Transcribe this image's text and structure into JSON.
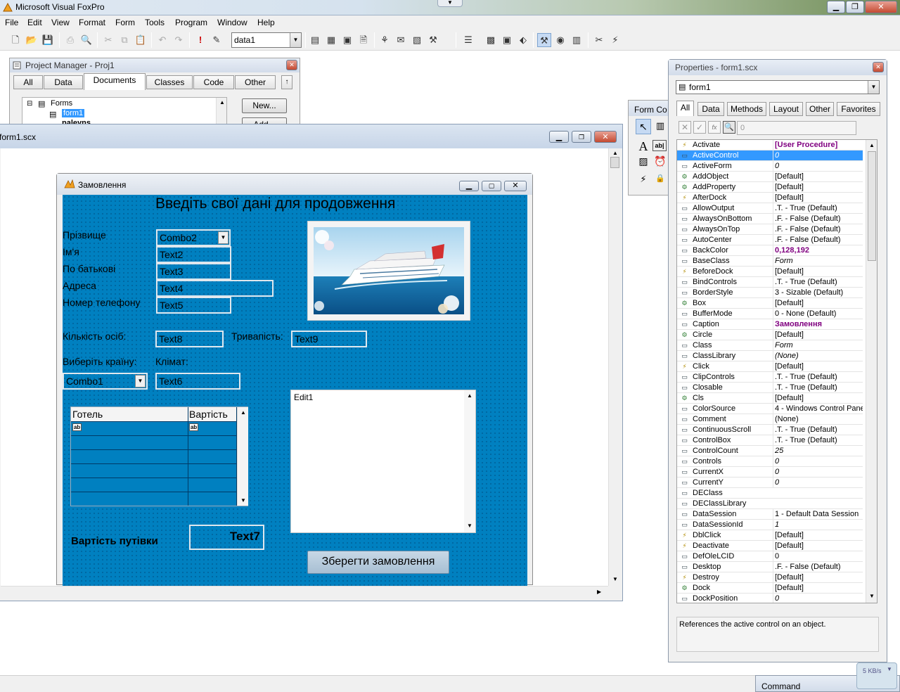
{
  "app": {
    "title": "Microsoft Visual FoxPro"
  },
  "menu": [
    "File",
    "Edit",
    "View",
    "Format",
    "Form",
    "Tools",
    "Program",
    "Window",
    "Help"
  ],
  "toolbar": {
    "datasession_value": "data1"
  },
  "project_manager": {
    "title": "Project Manager - Proj1",
    "tabs": [
      "All",
      "Data",
      "Documents",
      "Classes",
      "Code",
      "Other"
    ],
    "active_tab": "Documents",
    "tree": {
      "root": "Forms",
      "items": [
        "form1",
        "paleyns"
      ]
    },
    "new_button": "New...",
    "add_button": "Add..."
  },
  "form_designer": {
    "title": "form1.scx"
  },
  "form": {
    "caption": "Замовлення",
    "heading": "Введіть свої дані для продовження",
    "labels": {
      "surname": "Прізвище",
      "name": "Ім'я",
      "patronymic": "По батькові",
      "address": "Адреса",
      "phone": "Номер телефону",
      "persons": "Кількість осіб:",
      "duration": "Тривапість:",
      "country": "Виберіть країну:",
      "climate": "Клімат:",
      "trip_cost": "Вартість путівки"
    },
    "controls": {
      "combo2": "Combo2",
      "text2": "Text2",
      "text3": "Text3",
      "text4": "Text4",
      "text5": "Text5",
      "text8": "Text8",
      "text9": "Text9",
      "combo1": "Combo1",
      "text6": "Text6",
      "text7": "Text7",
      "edit1": "Edit1"
    },
    "grid": {
      "columns": [
        "Готель",
        "Вартість"
      ]
    },
    "save_button": "Зберегти замовлення"
  },
  "form_controls": {
    "title": "Form Co"
  },
  "properties": {
    "title": "Properties - form1.scx",
    "object": "form1",
    "tabs": [
      "All",
      "Data",
      "Methods",
      "Layout",
      "Other",
      "Favorites"
    ],
    "active_tab": "All",
    "value_box": "0",
    "rows": [
      {
        "name": "Activate",
        "value": "[User Procedure]",
        "kind": "event",
        "style": "purple"
      },
      {
        "name": "ActiveControl",
        "value": "0",
        "kind": "prop",
        "style": "ital",
        "selected": true
      },
      {
        "name": "ActiveForm",
        "value": "0",
        "kind": "prop",
        "style": "ital"
      },
      {
        "name": "AddObject",
        "value": "[Default]",
        "kind": "method"
      },
      {
        "name": "AddProperty",
        "value": "[Default]",
        "kind": "method"
      },
      {
        "name": "AfterDock",
        "value": "[Default]",
        "kind": "event"
      },
      {
        "name": "AllowOutput",
        "value": ".T. - True (Default)",
        "kind": "prop"
      },
      {
        "name": "AlwaysOnBottom",
        "value": ".F. - False (Default)",
        "kind": "prop"
      },
      {
        "name": "AlwaysOnTop",
        "value": ".F. - False (Default)",
        "kind": "prop"
      },
      {
        "name": "AutoCenter",
        "value": ".F. - False (Default)",
        "kind": "prop"
      },
      {
        "name": "BackColor",
        "value": "0,128,192",
        "kind": "prop",
        "style": "purple"
      },
      {
        "name": "BaseClass",
        "value": "Form",
        "kind": "prop",
        "style": "ital"
      },
      {
        "name": "BeforeDock",
        "value": "[Default]",
        "kind": "event"
      },
      {
        "name": "BindControls",
        "value": ".T. - True (Default)",
        "kind": "prop"
      },
      {
        "name": "BorderStyle",
        "value": "3 - Sizable (Default)",
        "kind": "prop"
      },
      {
        "name": "Box",
        "value": "[Default]",
        "kind": "method"
      },
      {
        "name": "BufferMode",
        "value": "0 - None (Default)",
        "kind": "prop"
      },
      {
        "name": "Caption",
        "value": "Замовлення",
        "kind": "prop",
        "style": "purple"
      },
      {
        "name": "Circle",
        "value": "[Default]",
        "kind": "method"
      },
      {
        "name": "Class",
        "value": "Form",
        "kind": "prop",
        "style": "ital"
      },
      {
        "name": "ClassLibrary",
        "value": "(None)",
        "kind": "prop",
        "style": "ital"
      },
      {
        "name": "Click",
        "value": "[Default]",
        "kind": "event"
      },
      {
        "name": "ClipControls",
        "value": ".T. - True (Default)",
        "kind": "prop"
      },
      {
        "name": "Closable",
        "value": ".T. - True (Default)",
        "kind": "prop"
      },
      {
        "name": "Cls",
        "value": "[Default]",
        "kind": "method"
      },
      {
        "name": "ColorSource",
        "value": "4 - Windows Control Panel",
        "kind": "prop"
      },
      {
        "name": "Comment",
        "value": "(None)",
        "kind": "prop"
      },
      {
        "name": "ContinuousScroll",
        "value": ".T. - True (Default)",
        "kind": "prop"
      },
      {
        "name": "ControlBox",
        "value": ".T. - True (Default)",
        "kind": "prop"
      },
      {
        "name": "ControlCount",
        "value": "25",
        "kind": "prop",
        "style": "ital"
      },
      {
        "name": "Controls",
        "value": "0",
        "kind": "prop",
        "style": "ital"
      },
      {
        "name": "CurrentX",
        "value": "0",
        "kind": "prop",
        "style": "ital"
      },
      {
        "name": "CurrentY",
        "value": "0",
        "kind": "prop",
        "style": "ital"
      },
      {
        "name": "DEClass",
        "value": "",
        "kind": "prop"
      },
      {
        "name": "DEClassLibrary",
        "value": "",
        "kind": "prop"
      },
      {
        "name": "DataSession",
        "value": "1 - Default Data Session",
        "kind": "prop"
      },
      {
        "name": "DataSessionId",
        "value": "1",
        "kind": "prop",
        "style": "ital"
      },
      {
        "name": "DblClick",
        "value": "[Default]",
        "kind": "event"
      },
      {
        "name": "Deactivate",
        "value": "[Default]",
        "kind": "event"
      },
      {
        "name": "DefOleLCID",
        "value": "0",
        "kind": "prop"
      },
      {
        "name": "Desktop",
        "value": ".F. - False (Default)",
        "kind": "prop"
      },
      {
        "name": "Destroy",
        "value": "[Default]",
        "kind": "event"
      },
      {
        "name": "Dock",
        "value": "[Default]",
        "kind": "method"
      },
      {
        "name": "DockPosition",
        "value": "0",
        "kind": "prop",
        "style": "ital"
      }
    ],
    "description": "References the active control on an object."
  },
  "command_window": {
    "title": "Command"
  },
  "net_widget": {
    "text": "5 KB/s"
  }
}
